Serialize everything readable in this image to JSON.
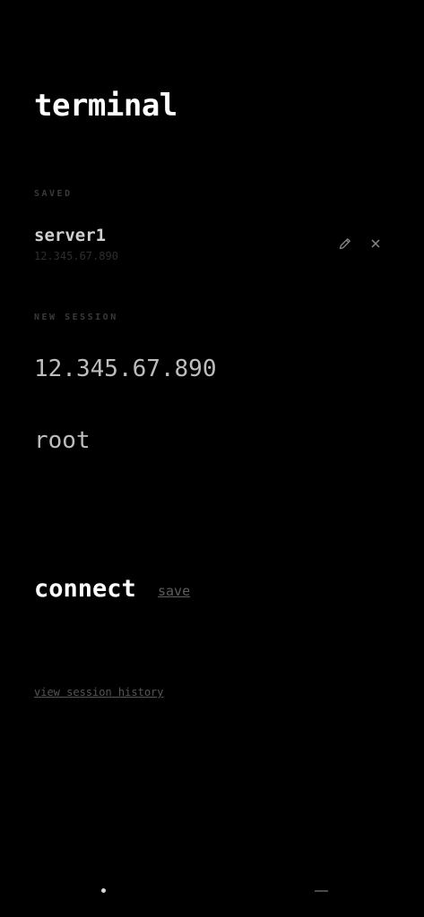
{
  "app": {
    "title": "terminal"
  },
  "saved": {
    "section_label": "SAVED",
    "items": [
      {
        "name": "server1",
        "host": "12.345.67.890",
        "edit_icon": "pencil-icon",
        "delete_icon": "close-icon"
      }
    ]
  },
  "new_session": {
    "section_label": "NEW SESSION",
    "host_value": "12.345.67.890",
    "user_value": "root"
  },
  "actions": {
    "connect_label": "connect",
    "save_label": "save",
    "history_label": "view session history"
  },
  "colors": {
    "background": "#000000",
    "title": "#ffffff",
    "muted_label": "#3a3a3a",
    "input_text": "#bdbdbd",
    "link": "#5c5c5c"
  }
}
